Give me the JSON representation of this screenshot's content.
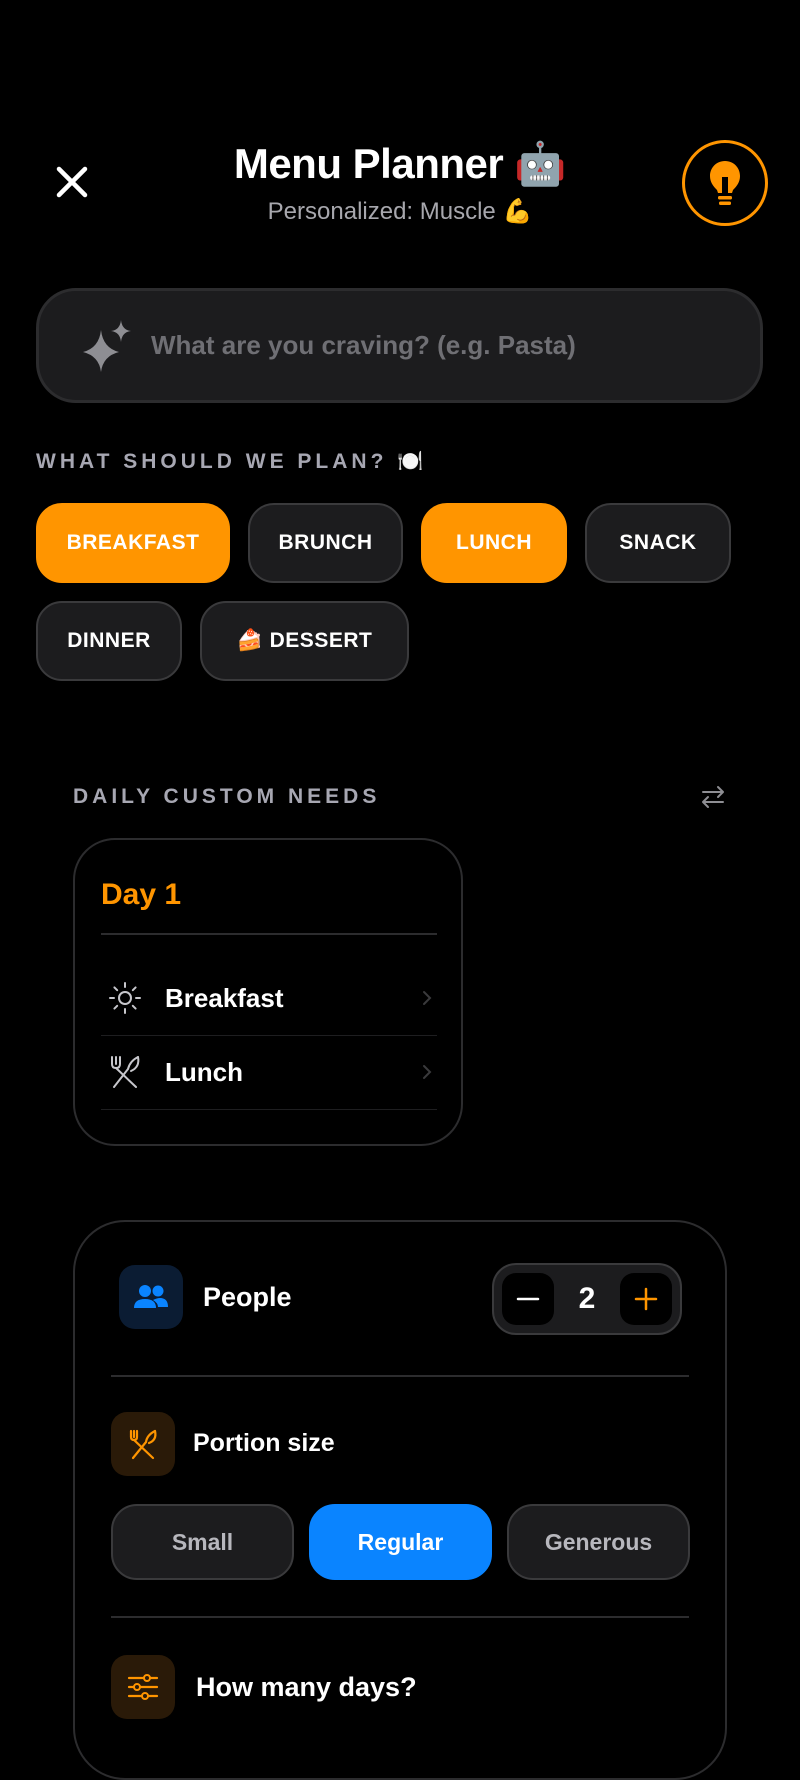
{
  "header": {
    "title": "Menu Planner 🤖",
    "subtitle": "Personalized: Muscle 💪"
  },
  "search": {
    "placeholder": "What are you craving? (e.g. Pasta)",
    "value": ""
  },
  "plan_section": {
    "label": "WHAT SHOULD WE PLAN? 🍽️",
    "chips": [
      {
        "label": "BREAKFAST",
        "selected": true
      },
      {
        "label": "BRUNCH",
        "selected": false
      },
      {
        "label": "LUNCH",
        "selected": true
      },
      {
        "label": "SNACK",
        "selected": false
      },
      {
        "label": "DINNER",
        "selected": false
      },
      {
        "label": "🍰 DESSERT",
        "selected": false
      }
    ]
  },
  "daily_needs": {
    "label": "DAILY CUSTOM NEEDS",
    "day": {
      "title": "Day 1",
      "meals": [
        {
          "label": "Breakfast",
          "icon": "sun-icon"
        },
        {
          "label": "Lunch",
          "icon": "utensils-icon"
        }
      ]
    }
  },
  "settings": {
    "people": {
      "label": "People",
      "value": "2",
      "icon": "people-icon"
    },
    "portion": {
      "label": "Portion size",
      "icon": "fork-knife-icon",
      "options": [
        "Small",
        "Regular",
        "Generous"
      ],
      "selected": "Regular"
    },
    "days": {
      "label": "How many days?",
      "icon": "sliders-icon"
    }
  },
  "colors": {
    "accent": "#ff9500",
    "selected_blue": "#0a84ff",
    "background": "#000000",
    "surface": "#1c1c1e"
  }
}
